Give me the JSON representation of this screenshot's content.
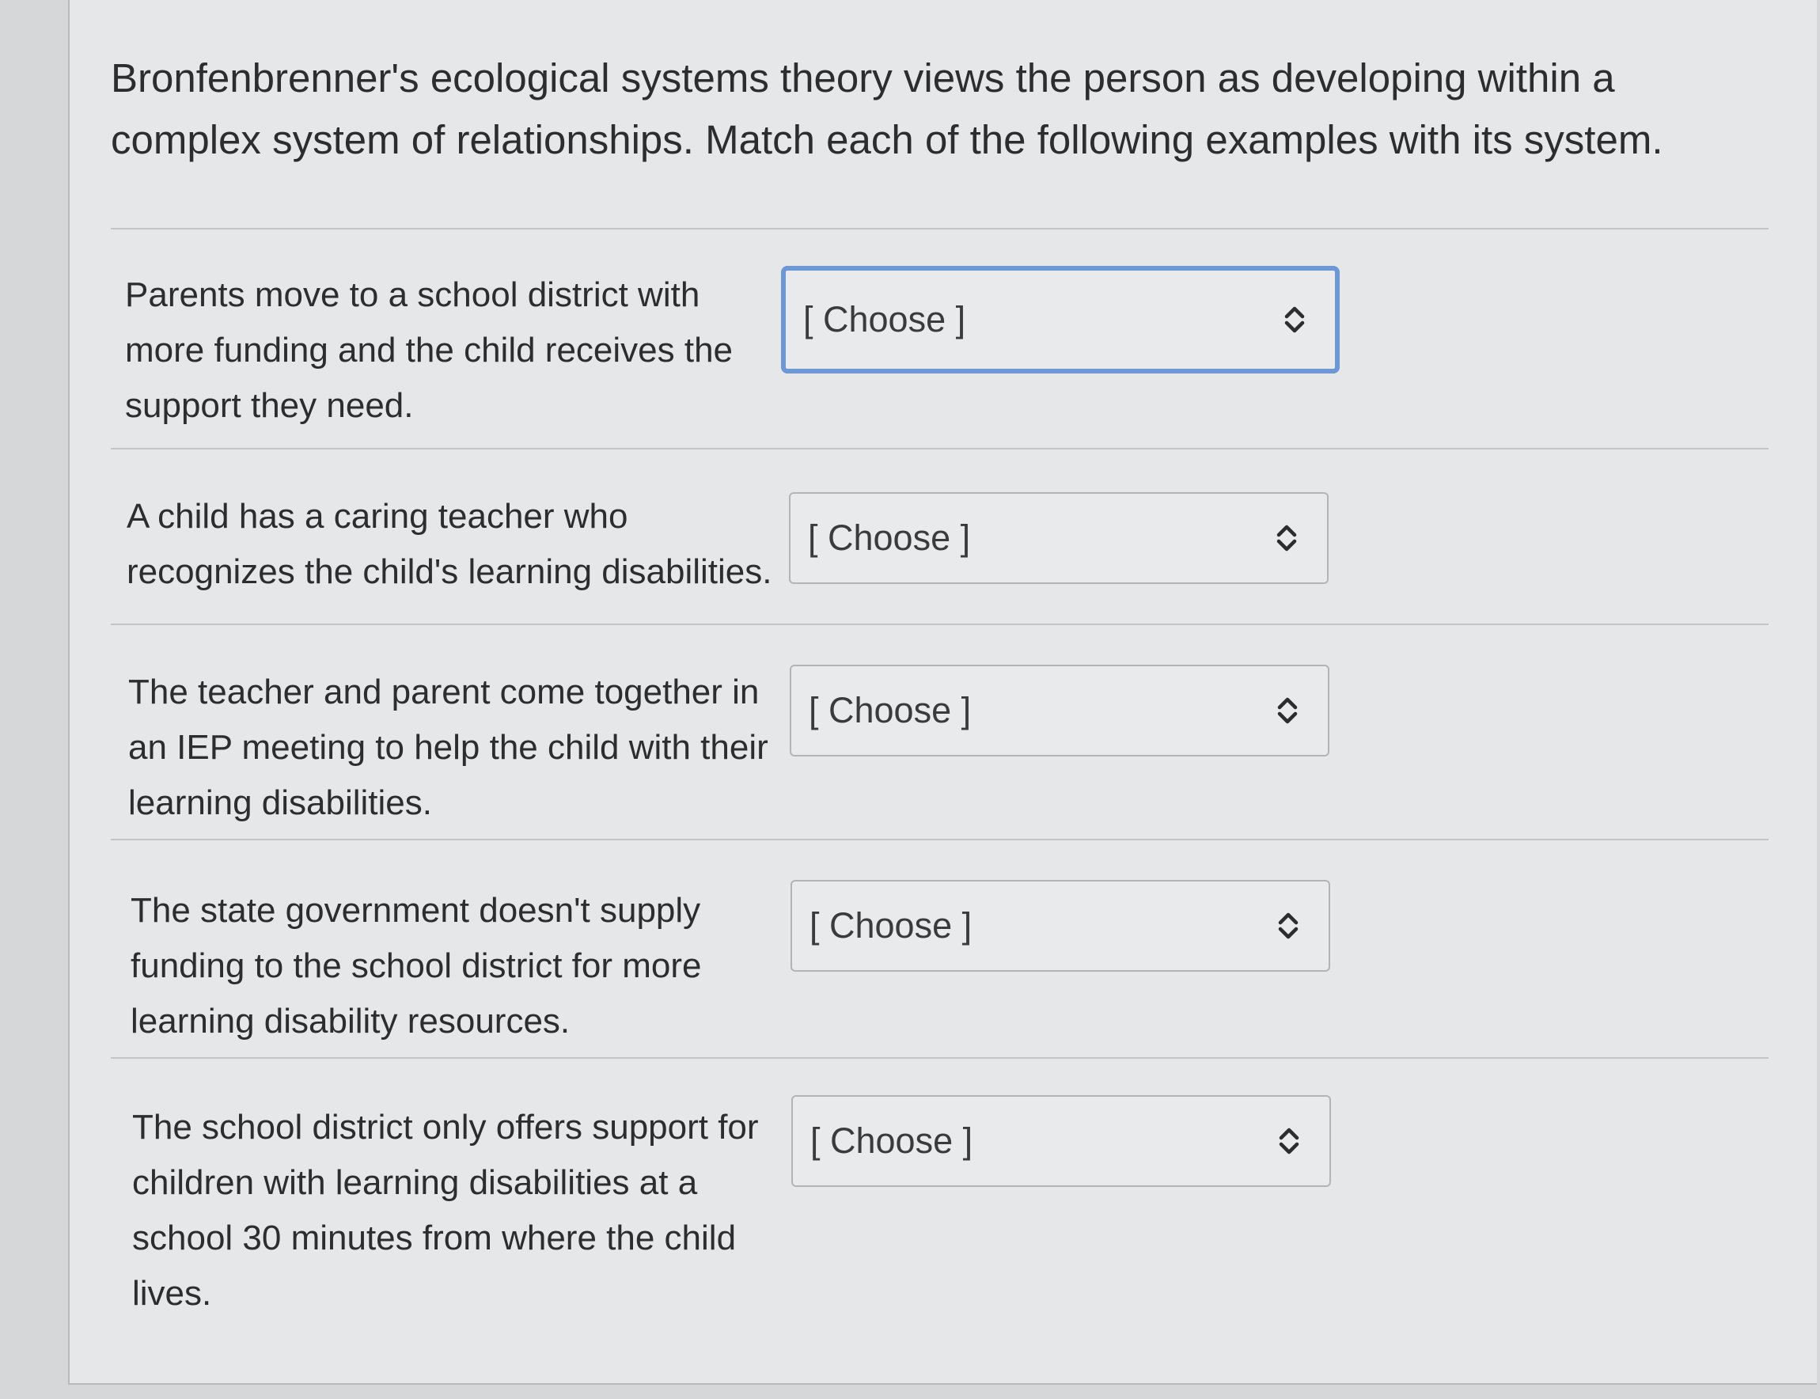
{
  "question": {
    "prompt": "Bronfenbrenner's ecological systems theory views the person as developing within a complex system of relationships. Match each of the following examples with its system."
  },
  "select_icon": "chevron-up-down-icon",
  "items": [
    {
      "text": "Parents move to a school district with more funding and the child receives the support they need.",
      "selected": "[ Choose ]"
    },
    {
      "text": "A child has a caring teacher who recognizes the child's learning disabilities.",
      "selected": "[ Choose ]"
    },
    {
      "text": "The teacher and parent come together in an IEP meeting to help the child with their learning disabilities.",
      "selected": "[ Choose ]"
    },
    {
      "text": "The state government doesn't supply funding to the school district for more learning disability resources.",
      "selected": "[ Choose ]"
    },
    {
      "text": "The school district only offers support for children with learning disabilities at a school 30 minutes from where the child lives.",
      "selected": "[ Choose ]"
    }
  ]
}
